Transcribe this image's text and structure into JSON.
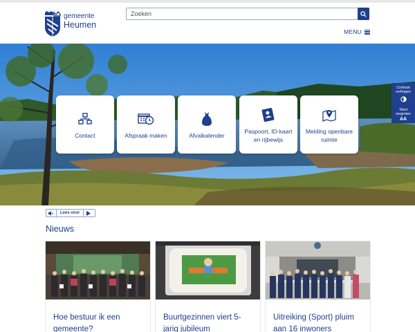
{
  "header": {
    "logo": {
      "line1": "gemeente",
      "line2": "Heumen"
    },
    "search": {
      "placeholder": "Zoeken"
    },
    "menu_label": "MENU"
  },
  "hero": {
    "tiles": [
      {
        "label": "Contact",
        "icon": "org-chart-icon"
      },
      {
        "label": "Afspraak maken",
        "icon": "calendar-clock-icon"
      },
      {
        "label": "Afvalkalender",
        "icon": "garbage-bag-icon"
      },
      {
        "label": "Paspoort, ID-kaart en rijbewijs",
        "icon": "id-card-icon"
      },
      {
        "label": "Melding openbare ruimte",
        "icon": "map-pin-icon"
      }
    ],
    "side_panel": {
      "contrast_label": "Contrast verhogen",
      "text_label": "Tekst vergroten",
      "text_glyph": "AA"
    }
  },
  "readspeaker": {
    "label": "Lees voor"
  },
  "news": {
    "title": "Nieuws",
    "items": [
      {
        "title": "Hoe bestuur ik een gemeente?"
      },
      {
        "title": "Buurtgezinnen viert 5-jarig jubileum"
      },
      {
        "title": "Uitreiking (Sport) pluim aan 16 inwoners"
      }
    ]
  },
  "colors": {
    "brand": "#1f3f8f",
    "sky": "#3b86d6"
  }
}
